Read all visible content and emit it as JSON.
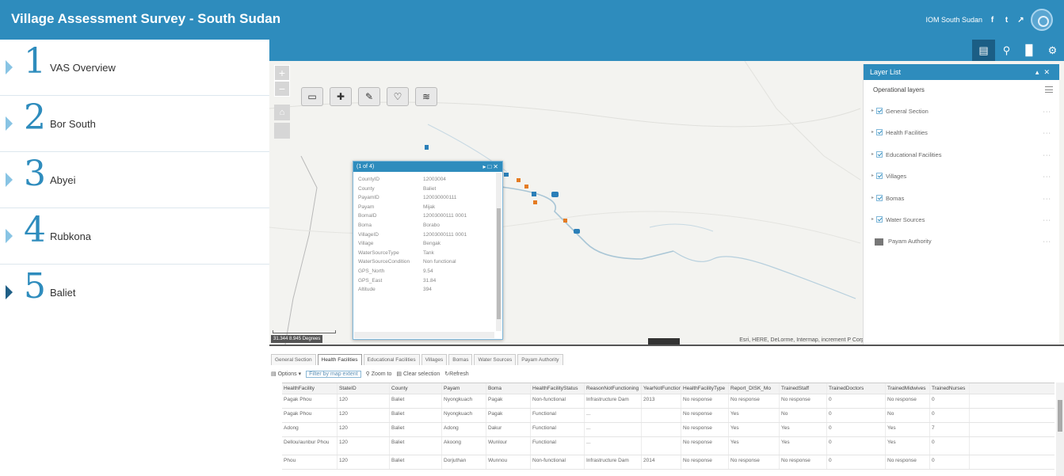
{
  "header": {
    "title": "Village Assessment Survey - South Sudan",
    "org_link": "IOM South Sudan",
    "social": [
      {
        "icon": "facebook-icon",
        "glyph": "f"
      },
      {
        "icon": "twitter-icon",
        "glyph": "t"
      },
      {
        "icon": "link-icon",
        "glyph": "↗"
      }
    ]
  },
  "sidebar": {
    "items": [
      {
        "number": "1",
        "label": "VAS Overview",
        "active": false
      },
      {
        "number": "2",
        "label": "Bor South",
        "active": false
      },
      {
        "number": "3",
        "label": "Abyei",
        "active": false
      },
      {
        "number": "4",
        "label": "Rubkona",
        "active": false
      },
      {
        "number": "5",
        "label": "Baliet",
        "active": true
      }
    ]
  },
  "map": {
    "zoom_in": "+",
    "zoom_out": "−",
    "attribution": "Esri, HERE, DeLorme, Intermap, increment P Corp.",
    "coordinates": "31.344 8.945 Degrees",
    "accent": "#2e8cbd"
  },
  "popup": {
    "title": "(1 of 4)",
    "fields": [
      {
        "key": "CountyID",
        "value": "12003004"
      },
      {
        "key": "County",
        "value": "Baliet"
      },
      {
        "key": "PayamID",
        "value": "120030000111"
      },
      {
        "key": "Payam",
        "value": "Mijak"
      },
      {
        "key": "BomaID",
        "value": "12003000111 0001"
      },
      {
        "key": "Boma",
        "value": "Borabo"
      },
      {
        "key": "VillageID",
        "value": "12003000111 0001"
      },
      {
        "key": "Village",
        "value": "Bengak"
      },
      {
        "key": "WaterSourceType",
        "value": "Tank"
      },
      {
        "key": "WaterSourceCondition",
        "value": "Non functional"
      },
      {
        "key": "GPS_North",
        "value": "9.54"
      },
      {
        "key": "GPS_East",
        "value": "31.84"
      },
      {
        "key": "Altitude",
        "value": "394"
      }
    ]
  },
  "layer_list": {
    "title": "Layer List",
    "operational_title": "Operational layers",
    "layers": [
      {
        "name": "General Section",
        "checked": true
      },
      {
        "name": "Health Facilities",
        "checked": true
      },
      {
        "name": "Educational Facilities",
        "checked": true
      },
      {
        "name": "Villages",
        "checked": true
      },
      {
        "name": "Bomas",
        "checked": true
      },
      {
        "name": "Water Sources",
        "checked": true
      }
    ],
    "table_layer": "Payam Authority"
  },
  "attribute_table": {
    "tabs": [
      "General Section",
      "Health Facilities",
      "Educational Facilities",
      "Villages",
      "Bomas",
      "Water Sources",
      "Payam Authority"
    ],
    "active_tab": 1,
    "toolbar": {
      "options": "Options ▾",
      "filter": "Filter by map extent",
      "zoom": "Zoom to",
      "clear": "Clear selection",
      "refresh": "Refresh"
    },
    "columns": [
      "HealthFacility",
      "StateID",
      "County",
      "Payam",
      "Boma",
      "HealthFacilityStatus",
      "ReasonNotFunctioning",
      "YearNotFunctioning",
      "HealthFacilityType",
      "Report_DISK_Mo",
      "TrainedStaff",
      "TrainedDoctors",
      "TrainedMidwives",
      "TrainedNurses"
    ],
    "rows": [
      [
        "Pagak Phou",
        "120",
        "Baliet",
        "Nyongkuach",
        "Pagak",
        "Non-functional",
        "Infrastructure Dam",
        "2013",
        "No response",
        "No response",
        "No response",
        "0",
        "No response",
        "0"
      ],
      [
        "Pagak Phou",
        "120",
        "Baliet",
        "Nyongkuach",
        "Pagak",
        "Functional",
        "...",
        "",
        "No response",
        "Yes",
        "No",
        "0",
        "No",
        "0"
      ],
      [
        "Adong",
        "120",
        "Baliet",
        "Adong",
        "Dakur",
        "Functional",
        "...",
        "",
        "No response",
        "Yes",
        "Yes",
        "0",
        "Yes",
        "7"
      ],
      [
        "Dellou/aunbur Phou",
        "120",
        "Baliet",
        "Akoong",
        "Wunlour",
        "Functional",
        "...",
        "",
        "No response",
        "Yes",
        "Yes",
        "0",
        "Yes",
        "0"
      ],
      [
        "Phou",
        "120",
        "Baliet",
        "Dorjuthan",
        "Wunnou",
        "Non-functional",
        "Infrastructure Dam",
        "2014",
        "No response",
        "No response",
        "No response",
        "0",
        "No response",
        "0"
      ]
    ]
  }
}
